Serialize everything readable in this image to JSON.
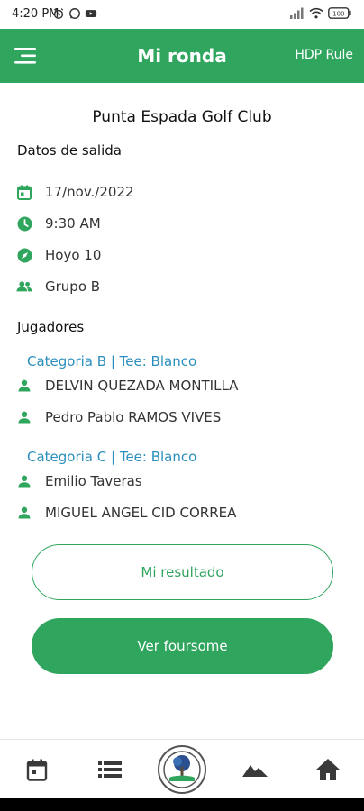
{
  "status": {
    "time": "4:20 PM",
    "battery": "100"
  },
  "app_bar": {
    "title": "Mi ronda",
    "hdp_label": "HDP Rule"
  },
  "club": {
    "name": "Punta Espada Golf Club"
  },
  "salida": {
    "heading": "Datos de salida",
    "date": "17/nov./2022",
    "time": "9:30 AM",
    "hole": "Hoyo 10",
    "group": "Grupo B"
  },
  "jugadores": {
    "heading": "Jugadores",
    "groups": [
      {
        "category": "Categoria B | Tee: Blanco",
        "players": [
          "DELVIN QUEZADA MONTILLA",
          "Pedro Pablo RAMOS VIVES"
        ]
      },
      {
        "category": "Categoria C | Tee: Blanco",
        "players": [
          "Emilio Taveras",
          "MIGUEL ANGEL CID CORREA"
        ]
      }
    ]
  },
  "buttons": {
    "result_label": "Mi resultado",
    "foursome_label": "Ver foursome"
  },
  "bottom_nav": [
    "calendar-icon",
    "list-icon",
    "club-logo",
    "mountain-icon",
    "home-icon"
  ],
  "colors": {
    "primary": "#2fa55e",
    "category": "#2b8fbd"
  }
}
